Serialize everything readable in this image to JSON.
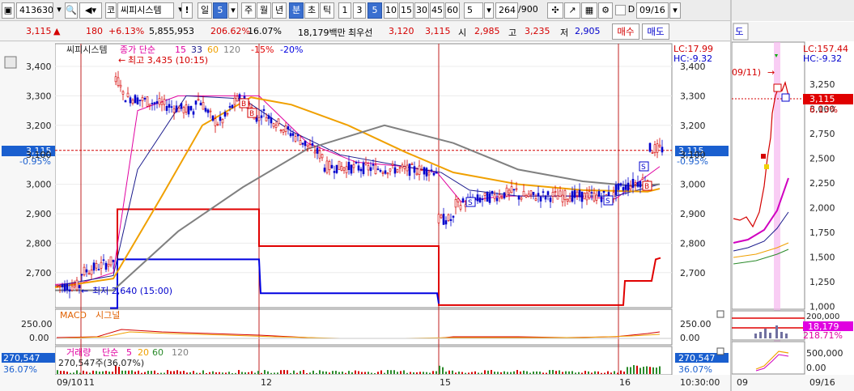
{
  "toolbar": {
    "stock_code": "413630",
    "stock_name": "씨피시스템",
    "exclaim": "!",
    "period_day": "일",
    "period_num": "5",
    "week": "주",
    "month": "월",
    "year": "년",
    "minute": "분",
    "second": "초",
    "tick": "틱",
    "intervals": [
      "1",
      "3",
      "5",
      "10",
      "15",
      "30",
      "45",
      "60"
    ],
    "interval_count": "5",
    "bars_shown": "264",
    "bars_total": "/900",
    "date_input": "09/16",
    "code_prefix": "코"
  },
  "quote": {
    "price": "3,115",
    "change": "180",
    "change_pct": "+6.13%",
    "volume": "5,855,953",
    "volume_ratio": "206.62%",
    "turnover_rate": "16.07%",
    "amount": "18,179백만",
    "best_ask_label": "최우선",
    "best_ask": "3,120",
    "best_bid": "3,115",
    "open_label": "시",
    "open": "2,985",
    "high_label": "고",
    "high": "3,235",
    "low_label": "저",
    "low": "2,905",
    "buy_button": "매수",
    "sell_button": "매도"
  },
  "chart_panel": {
    "legend_name": "씨피시스템",
    "legend_ma": "종가 단순",
    "ma_periods": [
      "15",
      "33",
      "60",
      "120"
    ],
    "envelope_low": "-15%",
    "envelope_low2": "-20%",
    "max_label": "최고 3,435 (10:15)",
    "min_label": "최저 2,640 (15:00)",
    "lc": "LC:17.99",
    "hc": "HC:-9.32",
    "price_tag": "3,115",
    "price_tag_pct": "-0.95%",
    "right_price_tag": "3,115",
    "right_price_pct": "-0.95%",
    "y_ticks": [
      "3,400",
      "3,300",
      "3,200",
      "3,100",
      "3,000",
      "2,900",
      "2,800",
      "2,700"
    ],
    "macd_title": "MACD",
    "macd_signal": "시그널",
    "macd_ticks": [
      "250.00",
      "0.00"
    ],
    "volume_title": "거래량",
    "volume_ma": "단순",
    "volume_periods": [
      "5",
      "20",
      "60",
      "120"
    ],
    "volume_value": "270,547주(36.07%)",
    "volume_tag": "270,547",
    "volume_tag_pct": "36.07%",
    "volume_left_tag": "270,547",
    "volume_left_pct": "36.07%",
    "x_labels": [
      "09/10",
      "11",
      "12",
      "15",
      "16"
    ],
    "time_label": "10:30:00"
  },
  "right_panel": {
    "header": "도",
    "lc": "LC:157.44",
    "hc": "HC:-9.32",
    "annotation": "09/11)",
    "y_ticks": [
      "3,250",
      "3,000",
      "2,750",
      "2,500",
      "2,250",
      "2,000",
      "1,750",
      "1,500",
      "1,250",
      "1,000"
    ],
    "price_tag": "3,115",
    "price_pct": "6.13%",
    "vol_tick": "200,000",
    "vol_tag": "18,179",
    "vol_pct": "218.71%",
    "amount_tick": "500,000",
    "amount_zero": "0.00",
    "x_labels": [
      "09",
      "09/16"
    ]
  },
  "colors": {
    "up": "#d40000",
    "down": "#0000cc",
    "ma_magenta": "#e000a0",
    "ma_navy": "#1a1a8c",
    "ma_orange": "#f0a000",
    "ma_gray": "#808080",
    "env_red": "#e00000",
    "env_blue": "#0000e0",
    "price_tag_bg": "#1a5fcf"
  }
}
